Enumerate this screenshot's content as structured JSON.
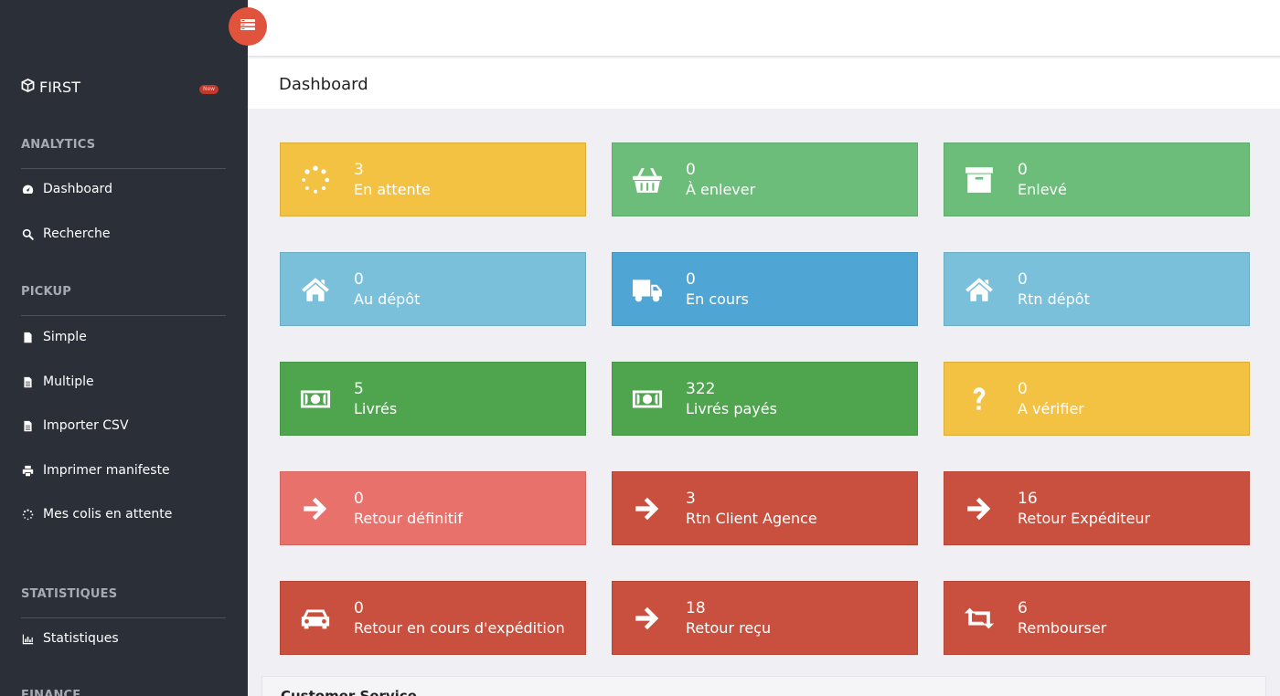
{
  "sidebar": {
    "brand": "FIRST",
    "badge": "New",
    "sections": [
      {
        "title": "ANALYTICS",
        "items": [
          "Dashboard",
          "Recherche"
        ]
      },
      {
        "title": "PICKUP",
        "items": [
          "Simple",
          "Multiple",
          "Importer CSV",
          "Imprimer manifeste",
          "Mes colis en attente"
        ]
      },
      {
        "title": "STATISTIQUES",
        "items": [
          "Statistiques"
        ]
      },
      {
        "title": "FINANCE",
        "items": []
      }
    ],
    "icons": {
      "brand": "cube-icon",
      "Dashboard": "tachometer-icon",
      "Recherche": "search-icon",
      "Simple": "file-icon",
      "Multiple": "file-text-icon",
      "Importer CSV": "file-text-icon",
      "Imprimer manifeste": "print-icon",
      "Mes colis en attente": "spinner-icon",
      "Statistiques": "bar-chart-icon"
    }
  },
  "toggle": {
    "icon": "menu-toggle-icon",
    "color": "#e0533d"
  },
  "header": {
    "title": "Dashboard"
  },
  "tiles": [
    {
      "value": "3",
      "label": "En attente",
      "color": "#f4c242",
      "icon": "spinner-icon"
    },
    {
      "value": "0",
      "label": "À enlever",
      "color": "#6cbd7a",
      "icon": "basket-icon"
    },
    {
      "value": "0",
      "label": "Enlevé",
      "color": "#6cbd7a",
      "icon": "archive-icon"
    },
    {
      "value": "0",
      "label": "Au dépôt",
      "color": "#7ac0da",
      "icon": "home-icon"
    },
    {
      "value": "0",
      "label": "En cours",
      "color": "#4fa6d4",
      "icon": "truck-icon"
    },
    {
      "value": "0",
      "label": "Rtn dépôt",
      "color": "#7ac0da",
      "icon": "home-icon"
    },
    {
      "value": "5",
      "label": "Livrés",
      "color": "#4ea54e",
      "icon": "money-icon"
    },
    {
      "value": "322",
      "label": "Livrés payés",
      "color": "#4ea54e",
      "icon": "money-icon"
    },
    {
      "value": "0",
      "label": "A vérifier",
      "color": "#f4c242",
      "icon": "question-icon"
    },
    {
      "value": "0",
      "label": "Retour définitif",
      "color": "#e8716c",
      "icon": "arrow-right-icon"
    },
    {
      "value": "3",
      "label": "Rtn Client Agence",
      "color": "#c9503e",
      "icon": "arrow-right-icon"
    },
    {
      "value": "16",
      "label": "Retour Expéditeur",
      "color": "#c9503e",
      "icon": "arrow-right-icon"
    },
    {
      "value": "0",
      "label": "Retour en cours d'expédition",
      "color": "#c9503e",
      "icon": "car-icon"
    },
    {
      "value": "18",
      "label": "Retour reçu",
      "color": "#c9503e",
      "icon": "arrow-right-icon"
    },
    {
      "value": "6",
      "label": "Rembourser",
      "color": "#c9503e",
      "icon": "retweet-icon"
    }
  ],
  "customer_service": {
    "title": "Customer Service"
  }
}
